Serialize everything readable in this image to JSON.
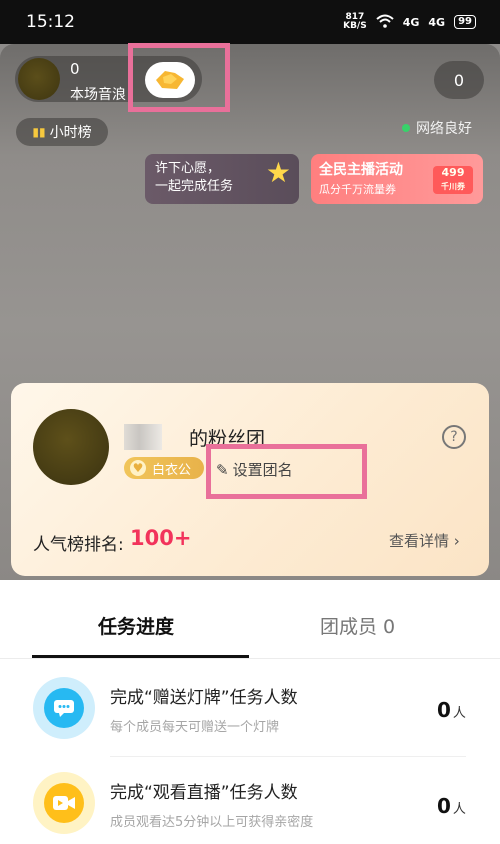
{
  "status_bar": {
    "time": "15:12",
    "net_speed_value": "817",
    "net_speed_unit": "KB/S",
    "signal1": "4G",
    "signal2": "4G",
    "battery": "99"
  },
  "live_room": {
    "host_count": "0",
    "host_subtitle": "本场音浪",
    "viewer_count": "0",
    "rank_label": "小时榜",
    "network_status": "网络良好",
    "wish_banner_line1": "许下心愿，",
    "wish_banner_line2": "一起完成任务",
    "event_title": "全民主播活动",
    "event_subtitle": "瓜分千万流量券",
    "event_tag_value": "499",
    "event_tag_unit": "千川券"
  },
  "fan_card": {
    "title": "的粉丝团",
    "level_badge": "白衣公",
    "set_name_label": "设置团名",
    "popularity_label": "人气榜排名:",
    "popularity_value": "100+",
    "details_label": "查看详情 ›",
    "help_symbol": "?"
  },
  "tabs": {
    "progress_label": "任务进度",
    "members_label": "团成员 0"
  },
  "tasks": [
    {
      "title": "完成“赠送灯牌”任务人数",
      "desc": "每个成员每天可赠送一个灯牌",
      "count": "0",
      "unit": "人"
    },
    {
      "title": "完成“观看直播”任务人数",
      "desc": "成员观看达5分钟以上可获得亲密度",
      "count": "0",
      "unit": "人"
    }
  ],
  "colors": {
    "accent_red": "#f2335b",
    "highlight_pink": "#e9709a",
    "badge_gold": "#e8b24a",
    "network_green": "#38d26a"
  }
}
